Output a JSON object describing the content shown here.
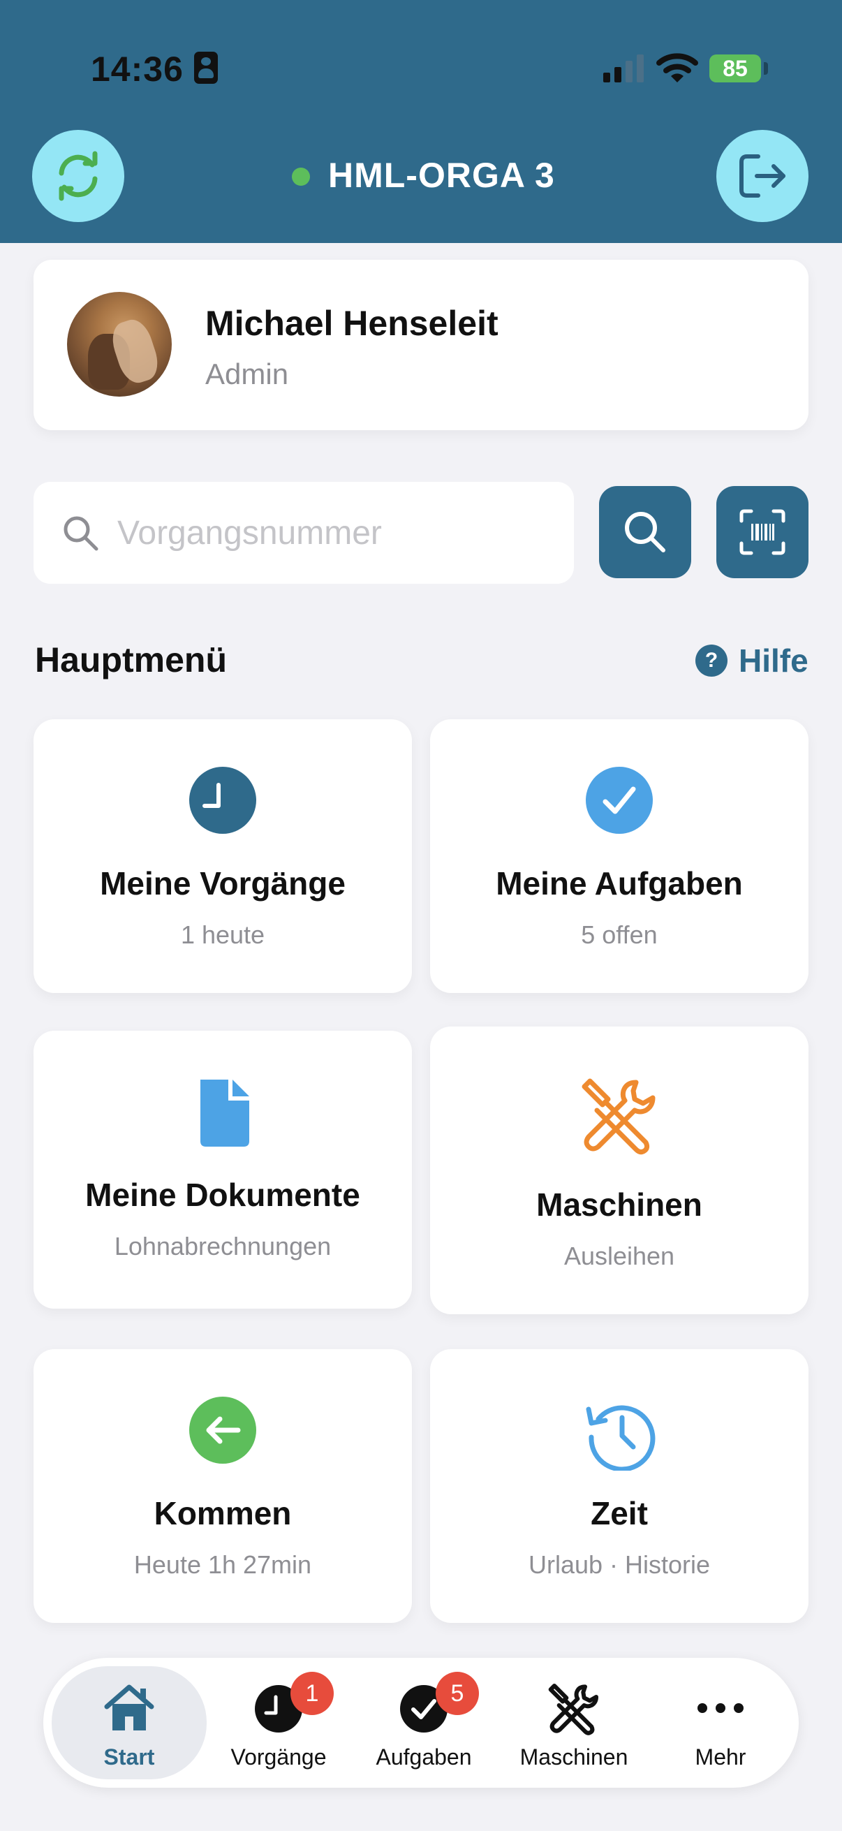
{
  "status_bar": {
    "time": "14:36",
    "battery": "85"
  },
  "header": {
    "title": "HML-ORGA 3",
    "sync_icon": "sync-icon",
    "logout_icon": "logout-icon",
    "status_color": "#5dbe5b",
    "bg_color": "#2f6a8b"
  },
  "profile": {
    "name": "Michael Henseleit",
    "role": "Admin"
  },
  "search": {
    "placeholder": "Vorgangsnummer"
  },
  "main_menu": {
    "title": "Hauptmenü",
    "help_label": "Hilfe",
    "tiles": [
      {
        "label": "Meine Vorgänge",
        "sub": "1 heute",
        "icon": "clock-icon"
      },
      {
        "label": "Meine Aufgaben",
        "sub": "5 offen",
        "icon": "check-icon"
      },
      {
        "label": "Meine Dokumente",
        "sub": "Lohnabrechnungen",
        "icon": "document-icon"
      },
      {
        "label": "Maschinen",
        "sub": "Ausleihen",
        "icon": "tools-icon"
      },
      {
        "label": "Kommen",
        "sub": "Heute 1h 27min",
        "icon": "arrow-left-icon"
      },
      {
        "label": "Zeit",
        "sub": "Urlaub · Historie",
        "icon": "history-icon"
      }
    ]
  },
  "bottom_nav": {
    "items": [
      {
        "label": "Start",
        "icon": "home-icon",
        "active": true
      },
      {
        "label": "Vorgänge",
        "icon": "clock-icon",
        "badge": "1"
      },
      {
        "label": "Aufgaben",
        "icon": "check-icon",
        "badge": "5"
      },
      {
        "label": "Maschinen",
        "icon": "tools-icon"
      },
      {
        "label": "Mehr",
        "icon": "more-icon"
      }
    ]
  }
}
